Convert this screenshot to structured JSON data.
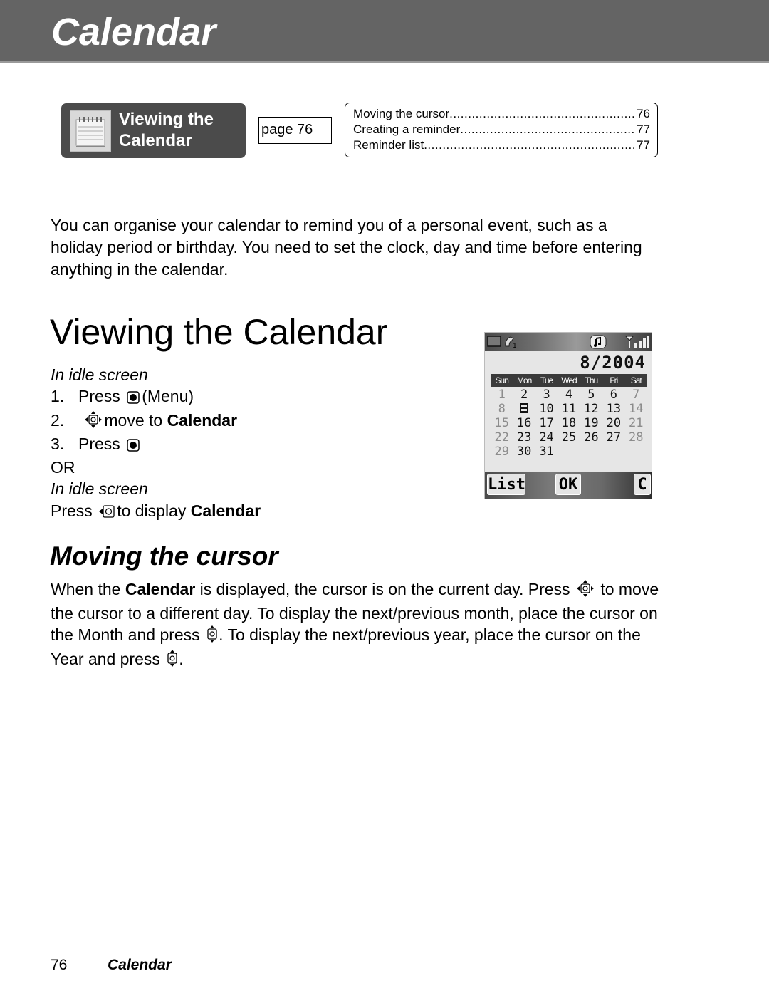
{
  "header": {
    "title": "Calendar"
  },
  "section_nav": {
    "icon": "calendar-notepad-icon",
    "title_line1": "Viewing the",
    "title_line2": "Calendar",
    "page_ref": "page 76",
    "toc": [
      {
        "label": "Moving the cursor",
        "page": "76"
      },
      {
        "label": "Creating a reminder ",
        "page": "77"
      },
      {
        "label": "Reminder list ",
        "page": "77"
      }
    ]
  },
  "intro": "You can organise your calendar to remind you of a personal event, such as a holiday period or birthday. You need to set the clock, day and time before entering anything in the calendar.",
  "viewing": {
    "heading": "Viewing the Calendar",
    "context1": "In idle screen",
    "steps": [
      {
        "num": "1.",
        "pre": "Press",
        "icon": "center-key-icon",
        "post": "(Menu)",
        "bold": ""
      },
      {
        "num": "2.",
        "pre": "",
        "icon": "navigation-key-icon",
        "post": "move to ",
        "bold": "Calendar"
      },
      {
        "num": "3.",
        "pre": "Press",
        "icon": "center-key-icon",
        "post": "",
        "bold": ""
      }
    ],
    "or": "OR",
    "context2": "In idle screen",
    "alt_pre": "Press",
    "alt_icon": "left-navigation-key-icon",
    "alt_post": "to display ",
    "alt_bold": "Calendar"
  },
  "phone_screen": {
    "status_icons": [
      "battery-icon",
      "line-1-icon",
      "vibrate-ring-icon",
      "signal-strength-icon"
    ],
    "month_year": "8/2004",
    "weekdays": [
      "Sun",
      "Mon",
      "Tue",
      "Wed",
      "Thu",
      "Fri",
      "Sat"
    ],
    "weeks": [
      [
        "1",
        "2",
        "3",
        "4",
        "5",
        "6",
        "7"
      ],
      [
        "8",
        "9",
        "10",
        "11",
        "12",
        "13",
        "14"
      ],
      [
        "15",
        "16",
        "17",
        "18",
        "19",
        "20",
        "21"
      ],
      [
        "22",
        "23",
        "24",
        "25",
        "26",
        "27",
        "28"
      ],
      [
        "29",
        "30",
        "31",
        "",
        "",
        "",
        ""
      ]
    ],
    "current_day": "9",
    "softkeys": {
      "left": "List",
      "center": "OK",
      "right": "C"
    }
  },
  "moving": {
    "heading": "Moving the cursor",
    "p1": "When the ",
    "p1_bold": "Calendar",
    "p2": " is displayed, the cursor is on the current day. Press",
    "p3": "to move the cursor to a different day. To display the next/previous month, place the cursor on the Month and press",
    "p4": ". To display the next/previous year, place the cursor on the Year and press",
    "p5": "."
  },
  "footer": {
    "page_number": "76",
    "section": "Calendar"
  }
}
